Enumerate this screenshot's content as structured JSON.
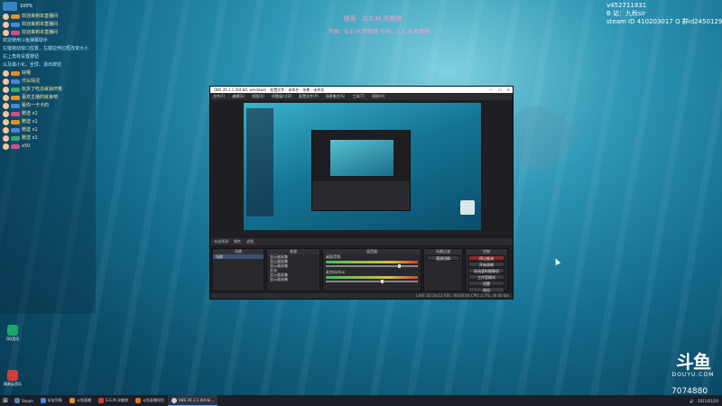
{
  "song": {
    "title": "怪哥 - G.E.M.邓紫棋",
    "credit": "作曲：G.E.M.邓紫棋 作词：G.E.M.邓紫棋"
  },
  "top_right": {
    "line1": "v452711831",
    "line2": "B 站：九秋sir",
    "line3": "steam ID 410203017  Q 群id2450129"
  },
  "left_panel": {
    "header": "100%",
    "rows": [
      {
        "kind": "badge",
        "text": "欢迎来到本直播间",
        "color": "#e0902f"
      },
      {
        "kind": "badge",
        "text": "欢迎来到本直播间",
        "color": "#4a86d6"
      },
      {
        "kind": "badge",
        "text": "欢迎来到本直播间",
        "color": "#d04f8a"
      },
      {
        "kind": "sys",
        "text": "欢迎使用斗鱼弹幕助手"
      },
      {
        "kind": "sys",
        "text": "左键拖动窗口位置，左键拉伸边框改变大小"
      },
      {
        "kind": "sys",
        "text": "右上角有设置按钮"
      },
      {
        "kind": "sys",
        "text": "以及最小化、全屏、退出按钮"
      },
      {
        "kind": "msg",
        "text": "好嗯",
        "color": "#e0902f"
      },
      {
        "kind": "msg",
        "text": "什么情况",
        "color": "#4a86d6"
      },
      {
        "kind": "msg",
        "text": "玩多了吃瓜就会厌倦",
        "color": "#3aa76d"
      },
      {
        "kind": "msg",
        "text": "喜欢主播的就来吧",
        "color": "#e0902f"
      },
      {
        "kind": "msg",
        "text": "看你一卡卡的",
        "color": "#4a86d6"
      },
      {
        "kind": "gift",
        "text": "赠送 x1",
        "color": "#d04f8a"
      },
      {
        "kind": "gift",
        "text": "赠送 x1",
        "color": "#e0902f"
      },
      {
        "kind": "gift",
        "text": "赠送 x1",
        "color": "#4a86d6"
      },
      {
        "kind": "gift",
        "text": "赠送 x1",
        "color": "#3aa76d"
      },
      {
        "kind": "gift",
        "text": "x50",
        "color": "#d04f8a"
      }
    ]
  },
  "desktop_icons": [
    {
      "label": "QQ音乐"
    },
    {
      "label": "网易云音乐"
    }
  ],
  "obs": {
    "title": "OBS 26.1.1 (64-bit, windows) - 配置文件：未命名 - 场景：未命名",
    "menu": [
      "文件(F)",
      "编辑(E)",
      "视图(V)",
      "停靠窗口(D)",
      "配置文件(P)",
      "场景集合(S)",
      "工具(T)",
      "帮助(H)"
    ],
    "window_controls": [
      "—",
      "☐",
      "✕"
    ],
    "mid_bar": {
      "left": "未选择源",
      "props": "属性",
      "filters": "滤镜"
    },
    "docks": {
      "scenes": {
        "head": "场景",
        "items": [
          "场景"
        ]
      },
      "sources": {
        "head": "来源",
        "items": [
          "显示器采集",
          "显示器采集",
          "显示器采集",
          "文本",
          "显示器采集",
          "显示器采集"
        ]
      },
      "mixer": {
        "head": "混音器",
        "tracks": [
          "桌面音频",
          "麦克风/Aux"
        ]
      },
      "transitions": {
        "head": "场景过渡",
        "value": "直接切换"
      },
      "controls": {
        "head": "控制",
        "buttons": [
          "停止推流",
          "开始录制",
          "启动虚拟摄像机",
          "工作室模式",
          "设置",
          "退出"
        ]
      }
    },
    "status": "LIVE: 02:34:12  REC: 00:00:00  CPU: 2.7%, 30.00 fps"
  },
  "douyu": {
    "mark": "斗鱼",
    "name": "DOUYU.COM"
  },
  "viewer_count": "7074880",
  "taskbar": {
    "start": "⊞",
    "items": [
      {
        "label": "Steam"
      },
      {
        "label": "好友列表"
      },
      {
        "label": "斗鱼直播"
      },
      {
        "label": "G.E.M.邓紫棋"
      },
      {
        "label": "斗鱼直播伴侣"
      },
      {
        "label": "OBS 26.1.1 (64-bi..."
      }
    ],
    "clock": "2021/01/20"
  }
}
